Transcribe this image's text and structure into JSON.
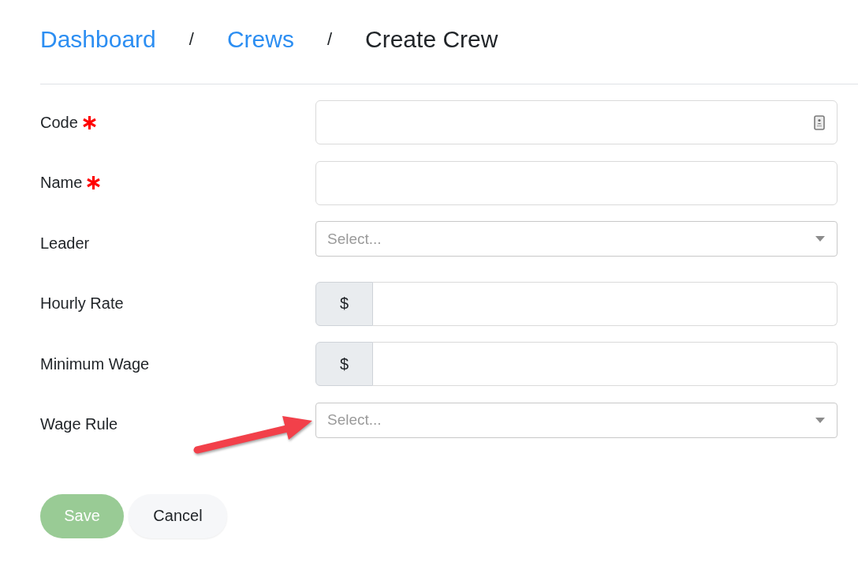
{
  "breadcrumb": [
    {
      "kind": "link",
      "label": "Dashboard"
    },
    {
      "kind": "separator",
      "label": "/"
    },
    {
      "kind": "link",
      "label": "Crews"
    },
    {
      "kind": "separator",
      "label": "/"
    },
    {
      "kind": "current",
      "label": "Create Crew"
    }
  ],
  "fields": [
    {
      "label": "Code",
      "required": true,
      "kind": "text",
      "autofill": true,
      "annotated": false
    },
    {
      "label": "Name",
      "required": true,
      "kind": "text",
      "autofill": false,
      "annotated": false
    },
    {
      "label": "Leader",
      "required": false,
      "kind": "select",
      "placeholder": "Select...",
      "autofill": false,
      "annotated": false
    },
    {
      "label": "Hourly Rate",
      "required": false,
      "kind": "currency",
      "prefix": "$",
      "autofill": false,
      "annotated": false
    },
    {
      "label": "Minimum Wage",
      "required": false,
      "kind": "currency",
      "prefix": "$",
      "autofill": false,
      "annotated": false
    },
    {
      "label": "Wage Rule",
      "required": false,
      "kind": "select",
      "placeholder": "Select...",
      "autofill": false,
      "annotated": true
    }
  ],
  "buttons": [
    {
      "label": "Save",
      "kind": "primary"
    },
    {
      "label": "Cancel",
      "kind": "secondary"
    }
  ]
}
